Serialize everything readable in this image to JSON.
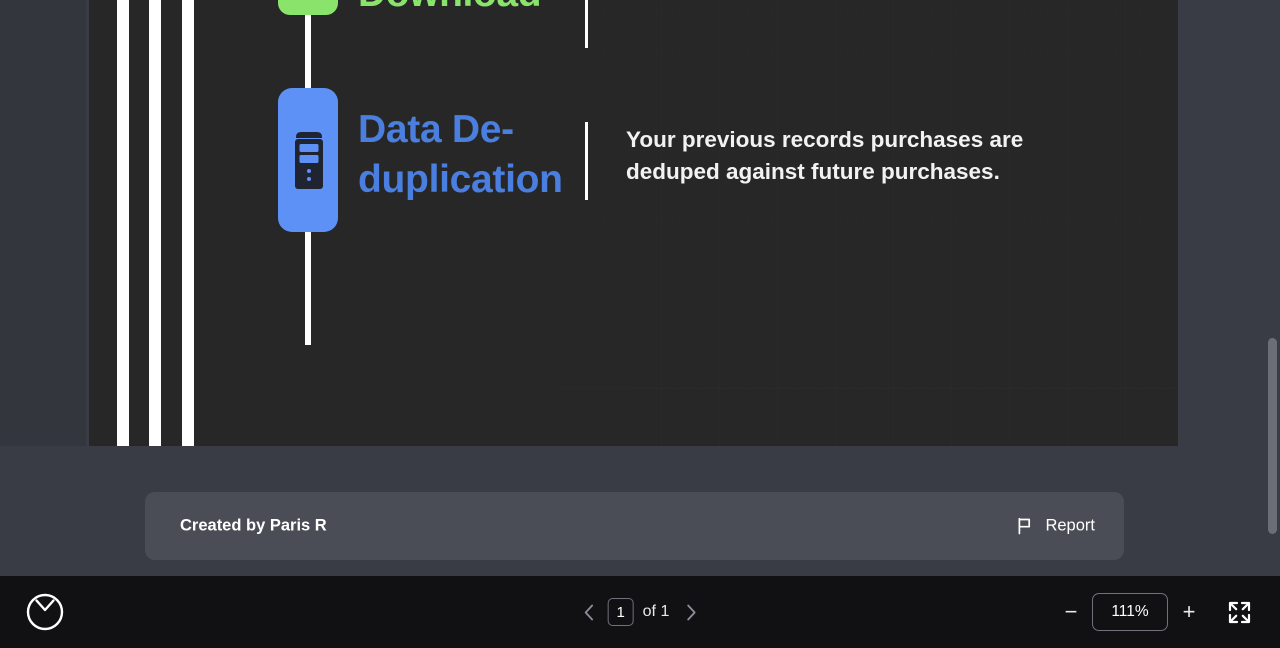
{
  "document": {
    "steps": [
      {
        "id": "download",
        "label": "Download",
        "accent": "#8ae46b",
        "icon": "download-chip-icon"
      },
      {
        "id": "data-deduplication",
        "label": "Data De-duplication",
        "accent": "#5d91f5",
        "icon": "server-rack-icon",
        "body": "Your previous records purchases are deduped against future purchases."
      }
    ]
  },
  "credits": {
    "created_by": "Created by Paris R",
    "report_label": "Report",
    "report_icon": "flag-icon"
  },
  "toolbar": {
    "logo_icon": "everand-circle-logo-icon",
    "prev_page_icon": "chevron-left-icon",
    "next_page_icon": "chevron-right-icon",
    "page_current": "1",
    "page_total": "of 1",
    "zoom_out_label": "−",
    "zoom_in_label": "+",
    "zoom_value": "111%",
    "fullscreen_icon": "expand-arrows-icon"
  },
  "scrollbar": {
    "name": "vertical-scrollbar"
  },
  "colors": {
    "page_background": "#272727",
    "viewer_background": "#393c44",
    "toolbar_background": "#111114",
    "credits_bar": "#4a4d55",
    "green_accent": "#8ae46b",
    "blue_accent": "#5d91f5",
    "blue_heading": "#4a7fe0",
    "scrollbar_thumb": "#6b6e77"
  }
}
